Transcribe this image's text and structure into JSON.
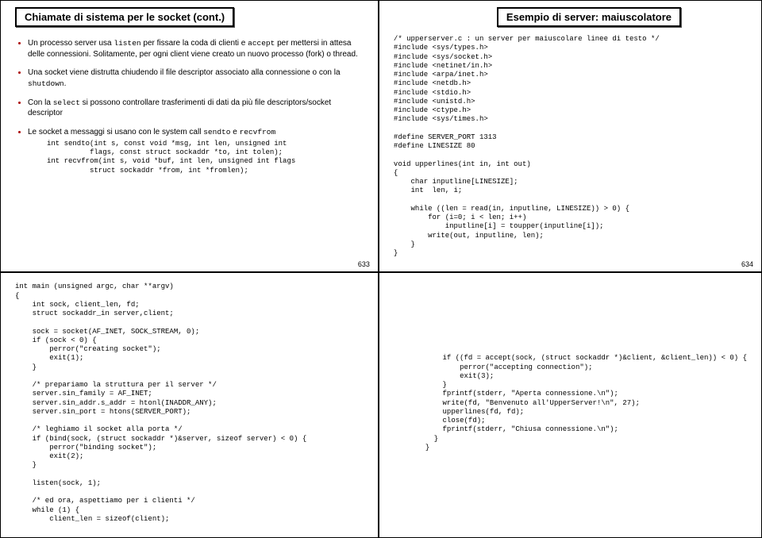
{
  "slides": {
    "tl": {
      "title": "Chiamate di sistema per le socket (cont.)",
      "bullet1_pre": "Un processo server usa ",
      "bullet1_code1": "listen",
      "bullet1_mid": " per fissare la coda di clienti e ",
      "bullet1_code2": "accept",
      "bullet1_post": " per mettersi in attesa delle connessioni. Solitamente, per ogni client viene creato un nuovo processo (fork) o thread.",
      "bullet2_pre": "Una socket viene distrutta chiudendo il file descriptor associato alla connessione o con la ",
      "bullet2_code": "shutdown",
      "bullet2_post": ".",
      "bullet3_pre": "Con la ",
      "bullet3_code": "select",
      "bullet3_post": " si possono controllare trasferimenti di dati da più file descriptors/socket descriptor",
      "bullet4_pre": "Le socket a messaggi si usano con le system call ",
      "bullet4_code1": "sendto",
      "bullet4_mid": " e ",
      "bullet4_code2": "recvfrom",
      "code": "int sendto(int s, const void *msg, int len, unsigned int\n          flags, const struct sockaddr *to, int tolen);\nint recvfrom(int s, void *buf, int len, unsigned int flags\n          struct sockaddr *from, int *fromlen);",
      "page": "633"
    },
    "tr": {
      "title": "Esempio di server: maiuscolatore",
      "code": "/* upperserver.c : un server per maiuscolare linee di testo */\n#include <sys/types.h>\n#include <sys/socket.h>\n#include <netinet/in.h>\n#include <arpa/inet.h>\n#include <netdb.h>\n#include <stdio.h>\n#include <unistd.h>\n#include <ctype.h>\n#include <sys/times.h>\n\n#define SERVER_PORT 1313\n#define LINESIZE 80\n\nvoid upperlines(int in, int out)\n{\n    char inputline[LINESIZE];\n    int  len, i;\n\n    while ((len = read(in, inputline, LINESIZE)) > 0) {\n        for (i=0; i < len; i++)\n            inputline[i] = toupper(inputline[i]);\n        write(out, inputline, len);\n    }\n}",
      "page": "634"
    },
    "bl": {
      "code": "int main (unsigned argc, char **argv)\n{\n    int sock, client_len, fd;\n    struct sockaddr_in server,client;\n\n    sock = socket(AF_INET, SOCK_STREAM, 0);\n    if (sock < 0) {\n        perror(\"creating socket\");\n        exit(1);\n    }\n\n    /* prepariamo la struttura per il server */\n    server.sin_family = AF_INET;\n    server.sin_addr.s_addr = htonl(INADDR_ANY);\n    server.sin_port = htons(SERVER_PORT);\n\n    /* leghiamo il socket alla porta */\n    if (bind(sock, (struct sockaddr *)&server, sizeof server) < 0) {\n        perror(\"binding socket\");\n        exit(2);\n    }\n\n    listen(sock, 1);\n\n    /* ed ora, aspettiamo per i clienti */\n    while (1) {\n        client_len = sizeof(client);"
    },
    "br": {
      "code": "    if ((fd = accept(sock, (struct sockaddr *)&client, &client_len)) < 0) {\n        perror(\"accepting connection\");\n        exit(3);\n    }\n    fprintf(stderr, \"Aperta connessione.\\n\");\n    write(fd, \"Benvenuto all'UpperServer!\\n\", 27);\n    upperlines(fd, fd);\n    close(fd);\n    fprintf(stderr, \"Chiusa connessione.\\n\");\n  }\n}"
    }
  }
}
